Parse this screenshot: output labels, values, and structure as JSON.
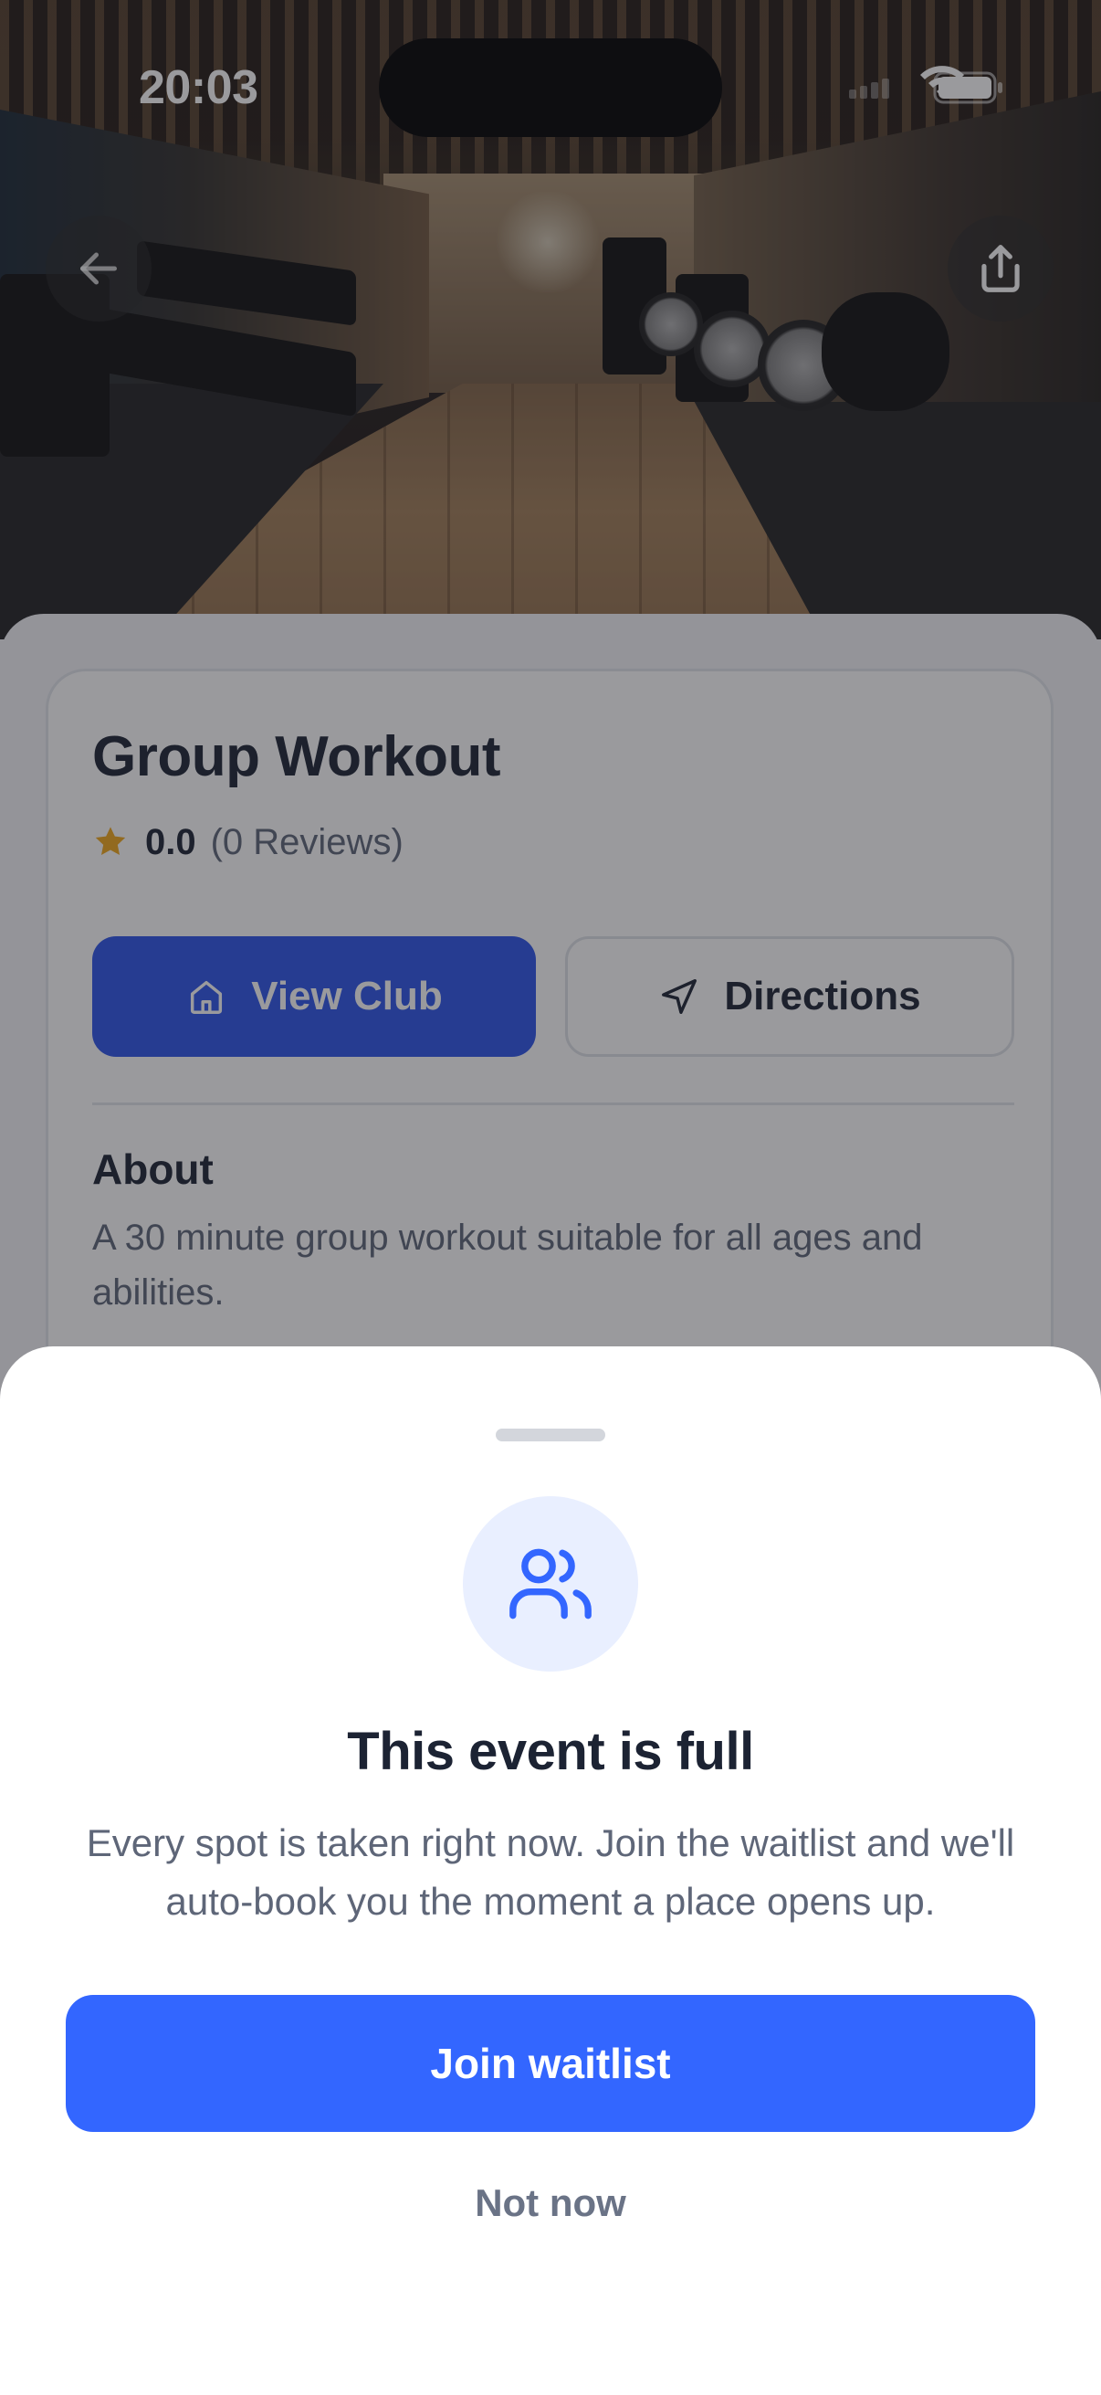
{
  "status_bar": {
    "time": "20:03"
  },
  "event": {
    "title": "Group Workout",
    "rating_score": "0.0",
    "rating_count": "(0 Reviews)",
    "actions": {
      "view_club": "View Club",
      "directions": "Directions"
    },
    "about_heading": "About",
    "about_text": "A 30 minute group workout suitable for all ages and abilities."
  },
  "sheet": {
    "title": "This event is full",
    "message": "Every spot is taken right now. Join the waitlist and we'll auto-book you the moment a place opens up.",
    "primary_button": "Join waitlist",
    "secondary_button": "Not now"
  },
  "icons": {
    "back": "arrow-left-icon",
    "share": "share-icon",
    "star": "star-icon",
    "club": "home-icon",
    "directions": "navigation-arrow-icon",
    "sheet": "users-icon"
  },
  "colors": {
    "primary": "#3366ff",
    "view_club_button": "#2c55ea",
    "star": "#f0a81c",
    "text_dark": "#1c2333",
    "text_muted": "#5e6678"
  }
}
